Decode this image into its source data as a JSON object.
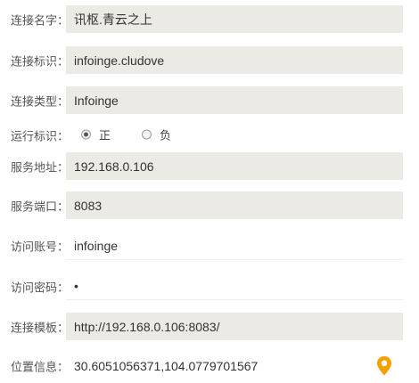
{
  "form": {
    "connection_name": {
      "label": "连接名字：",
      "value": "讯枢.青云之上"
    },
    "connection_id": {
      "label": "连接标识：",
      "value": "infoinge.cludove"
    },
    "connection_type": {
      "label": "连接类型：",
      "value": "Infoinge"
    },
    "run_flag": {
      "label": "运行标识：",
      "options": [
        "正",
        "负"
      ],
      "selected": "正"
    },
    "server_address": {
      "label": "服务地址：",
      "value": "192.168.0.106"
    },
    "server_port": {
      "label": "服务端口：",
      "value": "8083"
    },
    "access_account": {
      "label": "访问账号：",
      "value": "infoinge"
    },
    "access_password": {
      "label": "访问密码：",
      "value": "•"
    },
    "connection_template": {
      "label": "连接模板：",
      "value": "http://192.168.0.106:8083/"
    },
    "location": {
      "label": "位置信息：",
      "value": "30.6051056371,104.0779701567",
      "icon": "map-pin-icon",
      "icon_color": "#f5a000"
    }
  },
  "colors": {
    "field_background": "#ebeae4",
    "label_text": "#555555",
    "value_text": "#333333"
  }
}
